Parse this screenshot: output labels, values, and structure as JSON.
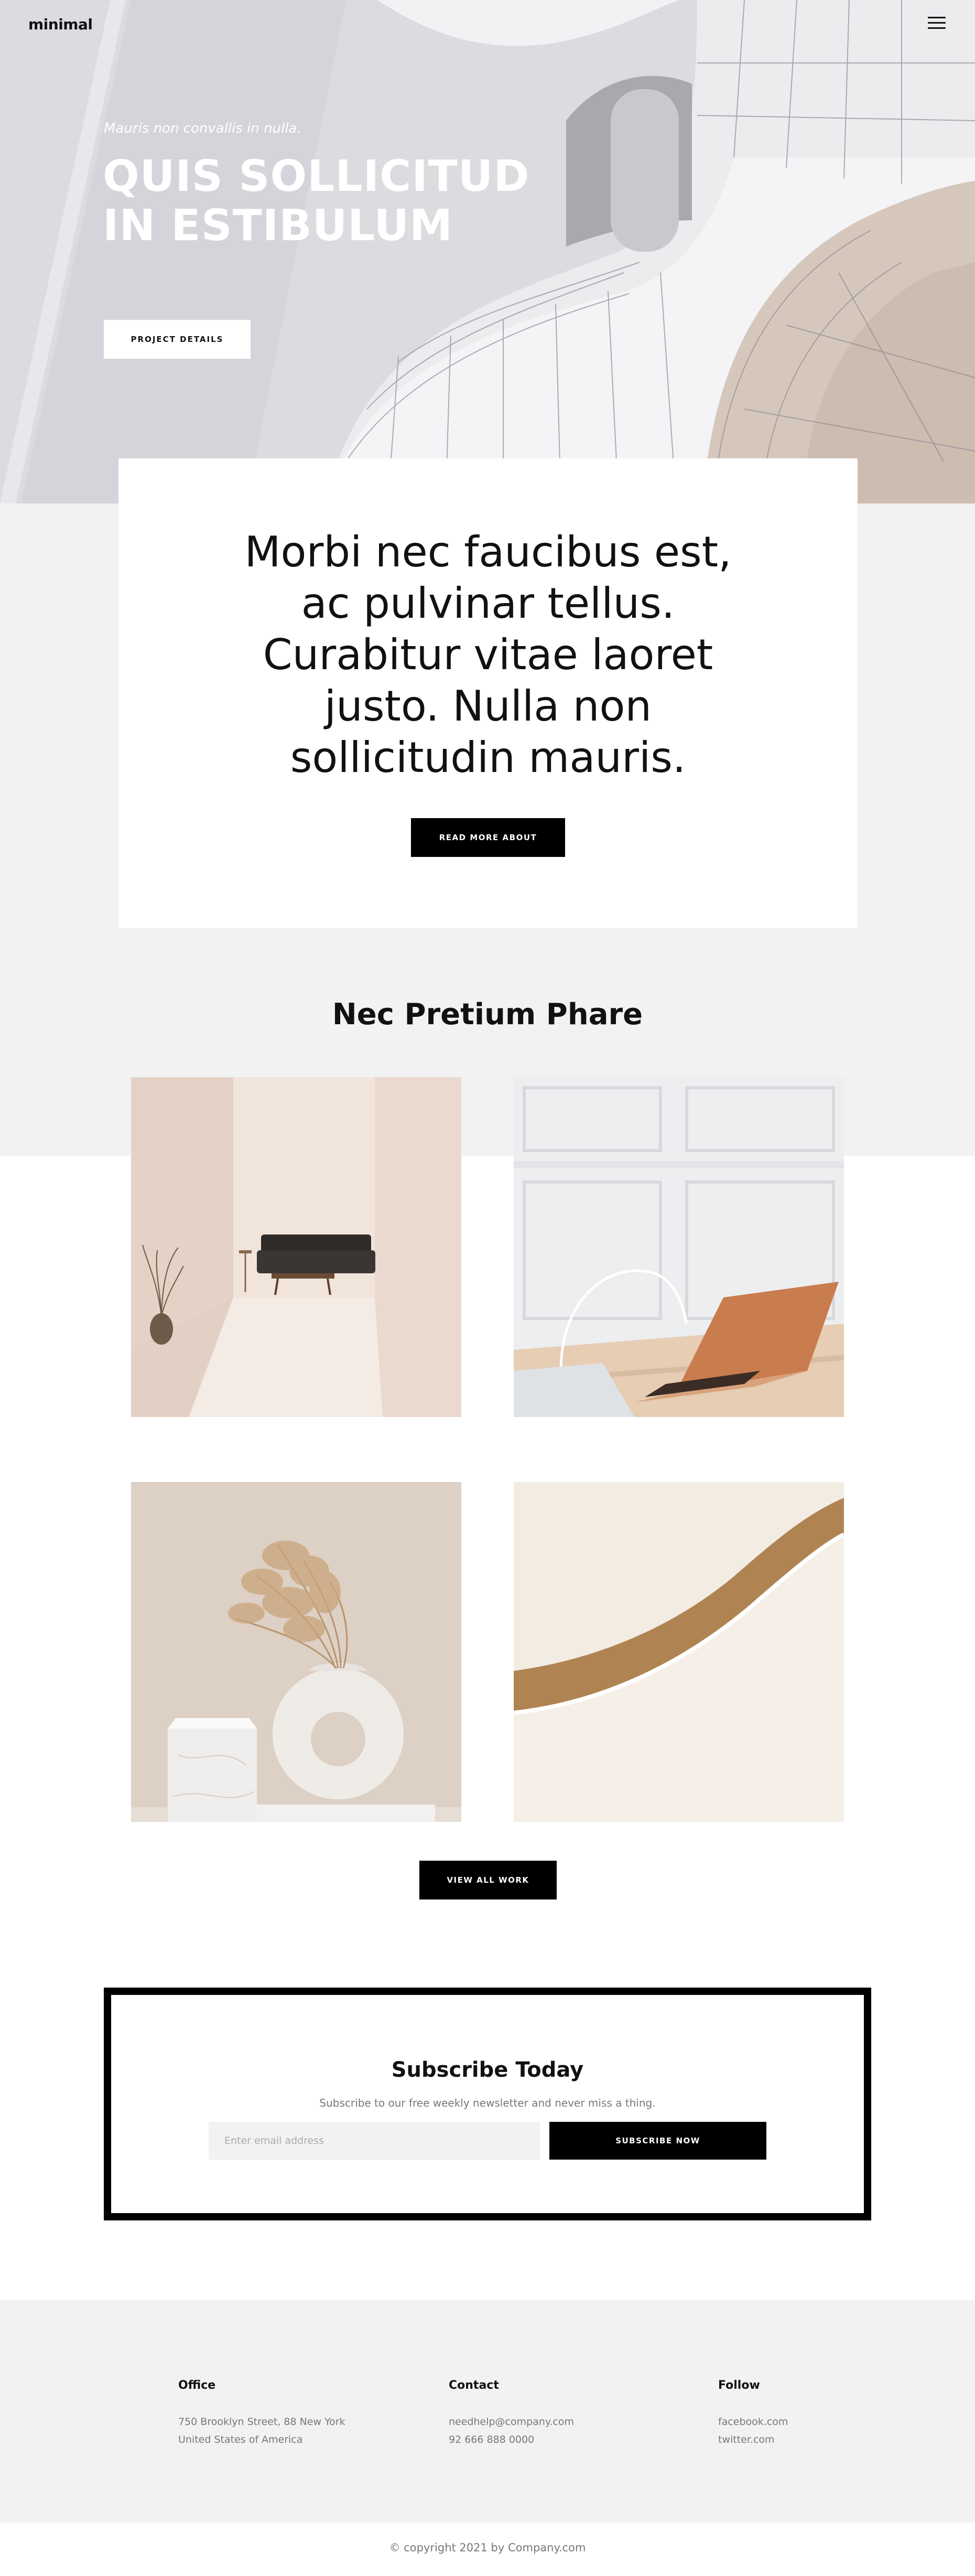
{
  "header": {
    "logo": "minimal",
    "menu_icon": "hamburger-menu-icon"
  },
  "hero": {
    "kicker": "Mauris non convallis in nulla.",
    "title_line1": "QUIS SOLLICITUD",
    "title_line2": "IN ESTIBULUM",
    "button": "PROJECT DETAILS"
  },
  "about": {
    "lines": [
      "Morbi nec faucibus est,",
      "ac pulvinar tellus.",
      "Curabitur vitae laoret",
      "justo. Nulla non",
      "sollicitudin mauris."
    ],
    "button": "READ MORE ABOUT"
  },
  "portfolio": {
    "title": "Nec Pretium Phare",
    "button": "VIEW ALL WORK"
  },
  "subscribe": {
    "title": "Subscribe Today",
    "description": "Subscribe to our free weekly newsletter and never miss a thing.",
    "placeholder": "Enter email address",
    "button": "SUBSCRIBE NOW"
  },
  "footer": {
    "office": {
      "heading": "Office",
      "line1": "750 Brooklyn Street, 88 New York",
      "line2": "United States of America"
    },
    "contact": {
      "heading": "Contact",
      "email": "needhelp@company.com",
      "phone": "92 666 888 0000"
    },
    "follow": {
      "heading": "Follow",
      "link1": "facebook.com",
      "link2": "twitter.com"
    },
    "copyright": "© copyright 2021 by Company.com"
  },
  "colors": {
    "accent": "#000000",
    "band": "#f2f2f2",
    "hero_bg": "#dcdbe0"
  }
}
